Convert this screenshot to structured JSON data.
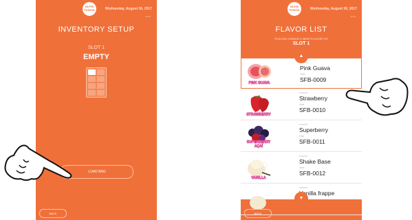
{
  "colors": {
    "screen_bg": "#f0703a",
    "list_bg": "#ffffff",
    "accent": "#f0703a",
    "tag_text": "#d3267e"
  },
  "left_screen": {
    "logo_text": "NUTRI FUSION",
    "date": "Wednesday, August 30, 2017",
    "menu_icon": "more-dots-icon",
    "title": "INVENTORY SETUP",
    "slot_label": "SLOT 1",
    "slot_status": "EMPTY",
    "load_bag_label": "LOAD BAG",
    "back_label": "BACK"
  },
  "right_screen": {
    "logo_text": "NUTRI FUSION",
    "date": "Wednesday, August 30, 2017",
    "title": "FLAVOR LIST",
    "instruction": "PLEASE ASSIGN A NEW FLAVOR TO",
    "slot": "SLOT 1",
    "flavor_key": "FLAVOR",
    "item_key": "ITEM",
    "items": [
      {
        "tag": "PINK GUAVA",
        "flavor": "Pink Guava",
        "item": "SFB-0009"
      },
      {
        "tag": "STRAWBERRY",
        "flavor": "Strawberry",
        "item": "SFB-0010"
      },
      {
        "tag": "SUPERBERRY AÇAÍ",
        "flavor": "Superberry",
        "item": "SFB-0011"
      },
      {
        "tag": "VANILLA",
        "flavor": "Shake Base",
        "item": "SFB-0012"
      },
      {
        "tag": "",
        "flavor": "Vanilla frappe",
        "item": ""
      }
    ],
    "back_label": "BACK"
  }
}
